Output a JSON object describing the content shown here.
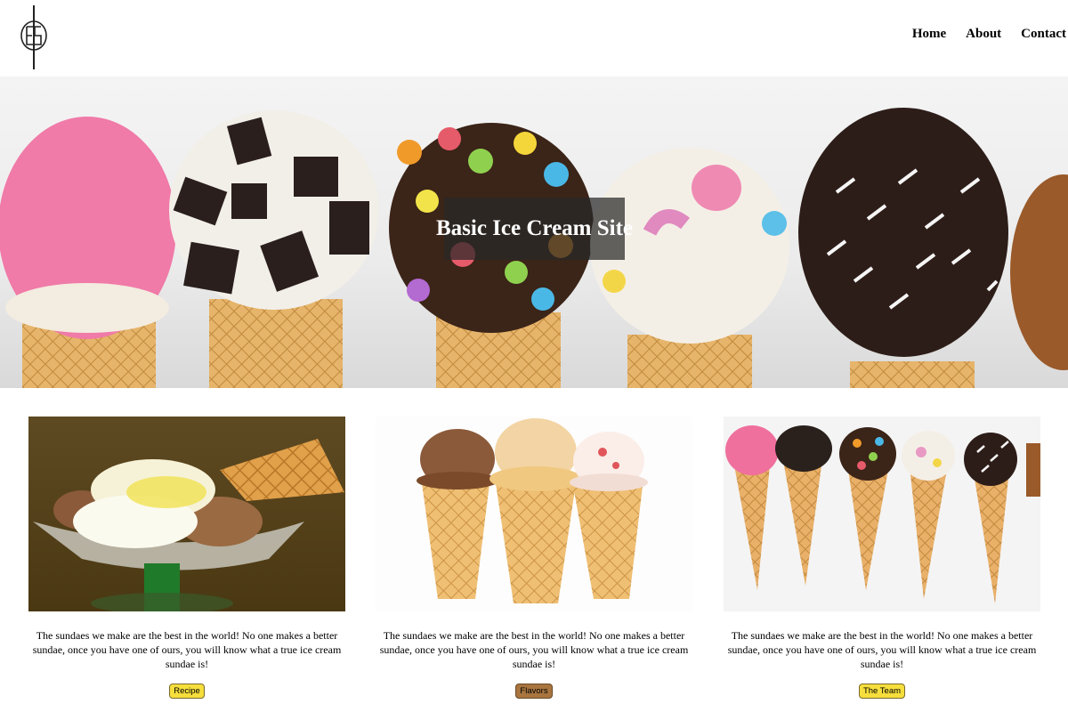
{
  "header": {
    "logo_icon": "monogram-logo-icon",
    "nav": [
      {
        "label": "Home"
      },
      {
        "label": "About"
      },
      {
        "label": "Contact"
      }
    ]
  },
  "hero": {
    "title": "Basic Ice Cream Site",
    "image": "row-of-topped-ice-cream-cones"
  },
  "cards": [
    {
      "image": "sundae-glass-with-waffle",
      "text": "The sundaes we make are the best in the world! No one makes a better sundae, once you have one of ours, you will know what a true ice cream sundae is!",
      "button": "Recipe",
      "button_color": "#f6df3c"
    },
    {
      "image": "three-ice-cream-cones",
      "text": "The sundaes we make are the best in the world! No one makes a better sundae, once you have one of ours, you will know what a true ice cream sundae is!",
      "button": "Flavors",
      "button_color": "#a8753f"
    },
    {
      "image": "row-of-decorated-cones",
      "text": "The sundaes we make are the best in the world! No one makes a better sundae, once you have one of ours, you will know what a true ice cream sundae is!",
      "button": "The Team",
      "button_color": "#f6df3c"
    }
  ]
}
